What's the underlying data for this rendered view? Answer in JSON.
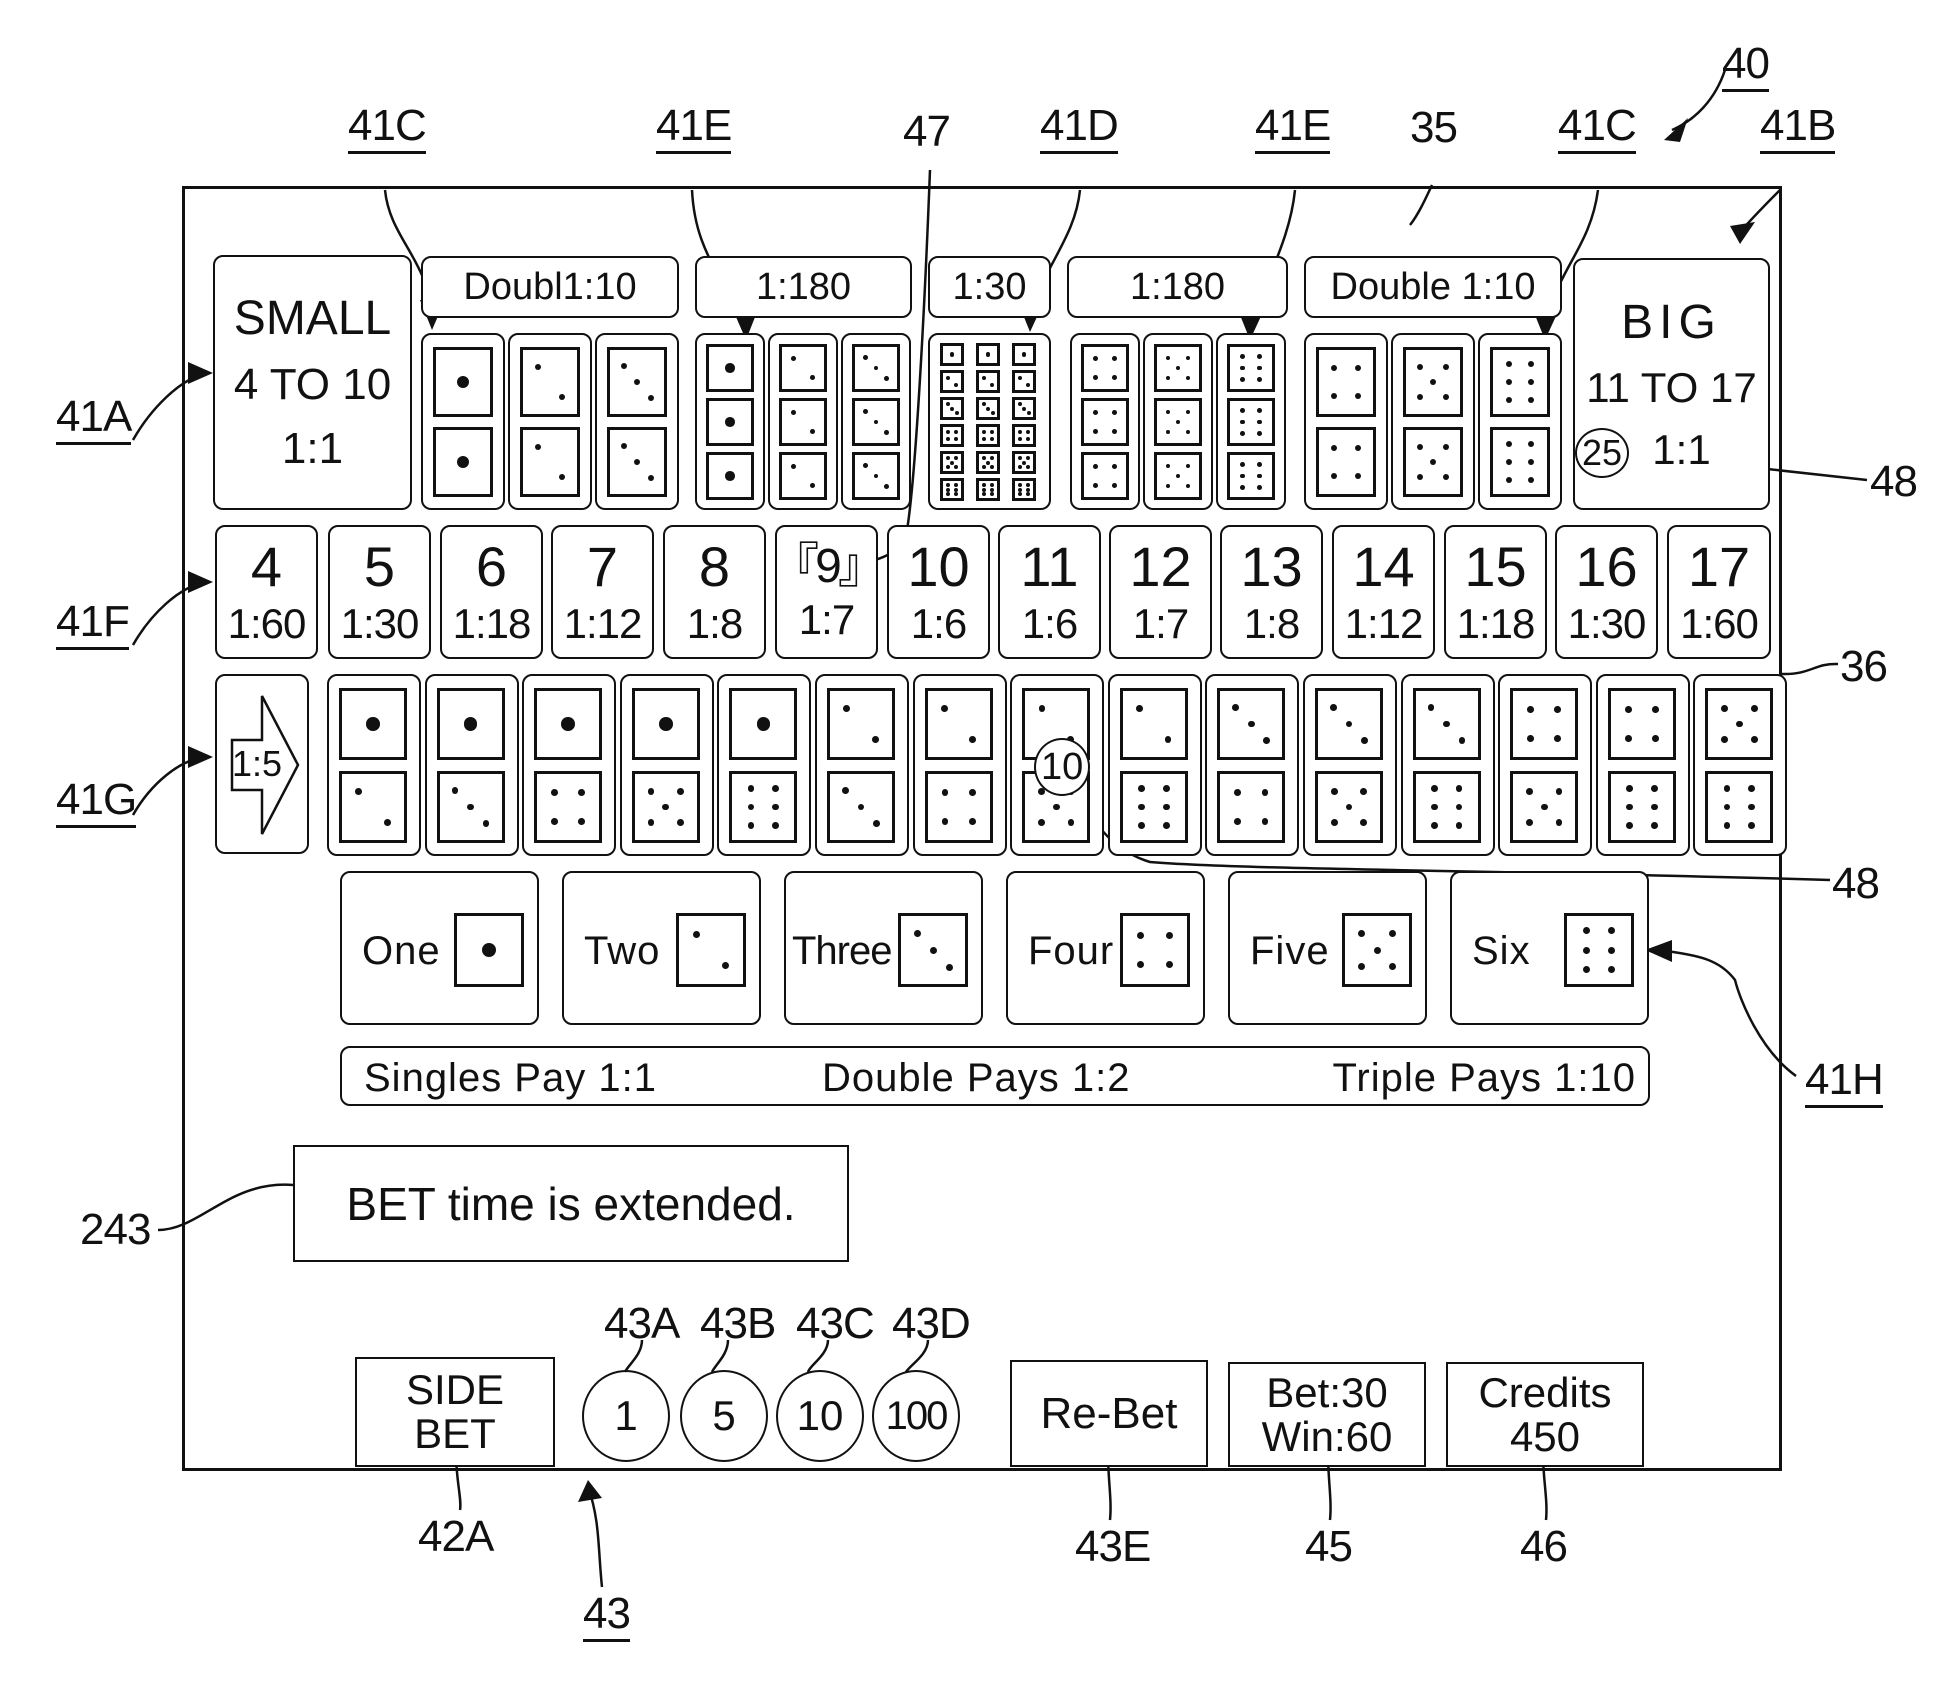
{
  "reference_labels": {
    "display": "40",
    "upper_area": "35",
    "frame": "36",
    "small": "41A",
    "big": "41B",
    "double_left": "41C",
    "double_right": "41C",
    "triple_left": "41E",
    "triple_right": "41E",
    "any_triple": "41D",
    "highlight": "47",
    "total_bets": "41F",
    "combinations": "41G",
    "singles": "41H",
    "chip_marker_big": "48",
    "chip_marker_combo": "48",
    "message": "243",
    "side_bet": "42A",
    "chip_1": "43A",
    "chip_5": "43B",
    "chip_10": "43C",
    "chip_100": "43D",
    "chip_group": "43",
    "rebet": "43E",
    "bet_win": "45",
    "credits": "46"
  },
  "small": {
    "title": "SMALL",
    "range": "4 TO 10",
    "odds": "1:1"
  },
  "big": {
    "title": "BIG",
    "range": "11 TO 17",
    "odds": "1:1",
    "chip_value": "25"
  },
  "headers": {
    "double_left": "Doubl1:10",
    "triple_left": "1:180",
    "any_triple": "1:30",
    "triple_right": "1:180",
    "double_right": "Double 1:10"
  },
  "doubles_left": [
    [
      1,
      1
    ],
    [
      2,
      2
    ],
    [
      3,
      3
    ]
  ],
  "triples_left": [
    [
      1,
      1,
      1
    ],
    [
      2,
      2,
      2
    ],
    [
      3,
      3,
      3
    ]
  ],
  "any_triple_faces": [
    1,
    2,
    3,
    4,
    5,
    6
  ],
  "triples_right": [
    [
      4,
      4,
      4
    ],
    [
      5,
      5,
      5
    ],
    [
      6,
      6,
      6
    ]
  ],
  "doubles_right": [
    [
      4,
      4
    ],
    [
      5,
      5
    ],
    [
      6,
      6
    ]
  ],
  "totals": [
    {
      "number": "4",
      "odds": "1:60"
    },
    {
      "number": "5",
      "odds": "1:30"
    },
    {
      "number": "6",
      "odds": "1:18"
    },
    {
      "number": "7",
      "odds": "1:12"
    },
    {
      "number": "8",
      "odds": "1:8"
    },
    {
      "number": "『9』",
      "odds": "1:7",
      "highlighted": true
    },
    {
      "number": "10",
      "odds": "1:6"
    },
    {
      "number": "11",
      "odds": "1:6"
    },
    {
      "number": "12",
      "odds": "1:7"
    },
    {
      "number": "13",
      "odds": "1:8"
    },
    {
      "number": "14",
      "odds": "1:12"
    },
    {
      "number": "15",
      "odds": "1:18"
    },
    {
      "number": "16",
      "odds": "1:30"
    },
    {
      "number": "17",
      "odds": "1:60"
    }
  ],
  "combination_odds": "1:5",
  "combinations": [
    [
      1,
      2
    ],
    [
      1,
      3
    ],
    [
      1,
      4
    ],
    [
      1,
      5
    ],
    [
      1,
      6
    ],
    [
      2,
      3
    ],
    [
      2,
      4
    ],
    [
      2,
      5
    ],
    [
      2,
      6
    ],
    [
      3,
      4
    ],
    [
      3,
      5
    ],
    [
      3,
      6
    ],
    [
      4,
      5
    ],
    [
      4,
      6
    ],
    [
      5,
      6
    ]
  ],
  "combination_chip": {
    "index": 7,
    "value": "10"
  },
  "singles": [
    {
      "label": "One",
      "face": 1
    },
    {
      "label": "Two",
      "face": 2
    },
    {
      "label": "Three",
      "face": 3
    },
    {
      "label": "Four",
      "face": 4
    },
    {
      "label": "Five",
      "face": 5
    },
    {
      "label": "Six",
      "face": 6
    }
  ],
  "pays": {
    "singles": "Singles Pay 1:1",
    "double": "Double Pays 1:2",
    "triple": "Triple Pays 1:10"
  },
  "message": "BET time is extended.",
  "controls": {
    "side_bet_line1": "SIDE",
    "side_bet_line2": "BET",
    "chips": [
      "1",
      "5",
      "10",
      "100"
    ],
    "rebet": "Re-Bet",
    "bet_line": "Bet:30",
    "win_line": "Win:60",
    "credits_label": "Credits",
    "credits_value": "450"
  }
}
